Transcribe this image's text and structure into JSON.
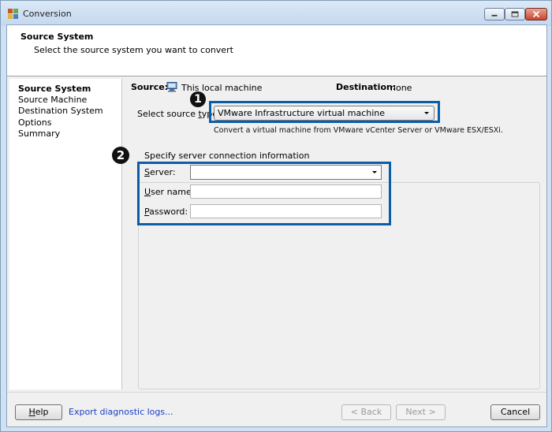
{
  "window": {
    "title": "Conversion"
  },
  "header": {
    "title": "Source System",
    "subtitle": "Select the source system you want to convert"
  },
  "nav": {
    "items": [
      {
        "label": "Source System",
        "active": true
      },
      {
        "label": "Source Machine",
        "active": false
      },
      {
        "label": "Destination System",
        "active": false
      },
      {
        "label": "Options",
        "active": false
      },
      {
        "label": "Summary",
        "active": false
      }
    ]
  },
  "source": {
    "label": "Source:",
    "value": "This local machine"
  },
  "destination": {
    "label": "Destination:",
    "value": "none"
  },
  "source_type": {
    "label": "Select source type:",
    "selected": "VMware Infrastructure virtual machine",
    "description": "Convert a virtual machine from VMware vCenter Server or VMware ESX/ESXi."
  },
  "connection": {
    "legend": "Specify server connection information",
    "server_label": "Server:",
    "server_value": "",
    "username_label": "User name:",
    "username_value": "",
    "password_label": "Password:",
    "password_value": ""
  },
  "callouts": {
    "one": "1",
    "two": "2"
  },
  "footer": {
    "help": "Help",
    "export_logs": "Export diagnostic logs...",
    "back": "< Back",
    "next": "Next >",
    "cancel": "Cancel"
  },
  "colors": {
    "callout_border": "#0a5ea8",
    "link": "#1a3ec5"
  }
}
